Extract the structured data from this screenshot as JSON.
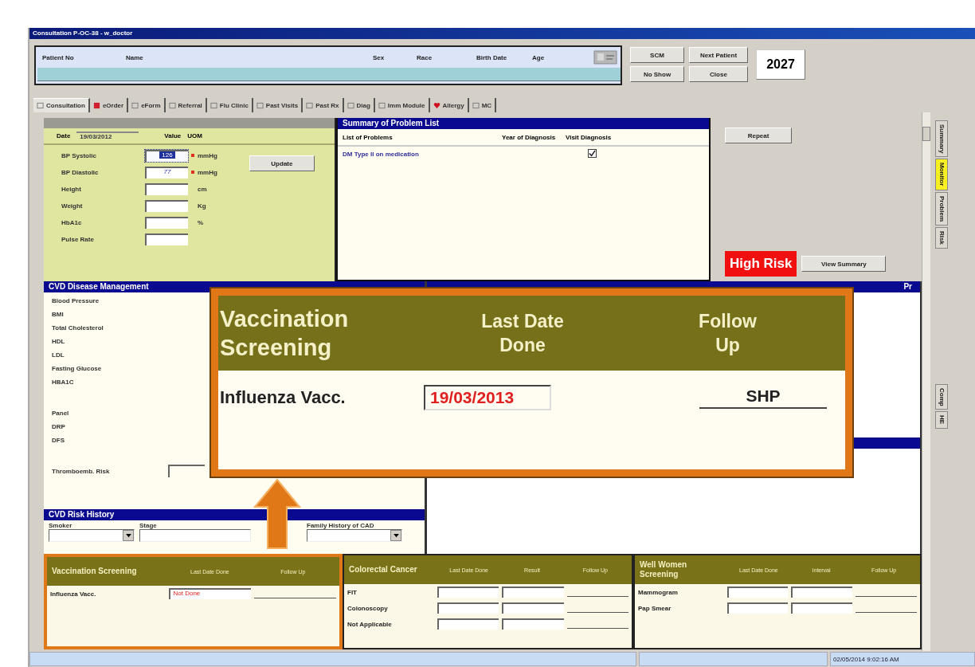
{
  "window": {
    "title": "Consultation P-OC-38 - w_doctor"
  },
  "patient": {
    "columns": [
      "Patient No",
      "Name",
      "Sex",
      "Race",
      "Birth Date",
      "Age"
    ]
  },
  "header_buttons": [
    "SCM",
    "Next Patient",
    "No Show",
    "Close"
  ],
  "queue_number": "2027",
  "tabs": [
    {
      "label": "Consultation",
      "kind": "box",
      "selected": true
    },
    {
      "label": "eOrder",
      "kind": "order",
      "selected": false
    },
    {
      "label": "eForm",
      "kind": "box",
      "selected": false
    },
    {
      "label": "Referral",
      "kind": "box",
      "selected": false
    },
    {
      "label": "Flu Clinic",
      "kind": "box",
      "selected": false
    },
    {
      "label": "Past Visits",
      "kind": "box",
      "selected": false
    },
    {
      "label": "Past Rx",
      "kind": "box",
      "selected": false
    },
    {
      "label": "Diag",
      "kind": "box",
      "selected": false
    },
    {
      "label": "Imm Module",
      "kind": "box",
      "selected": false
    },
    {
      "label": "Allergy",
      "kind": "heart",
      "selected": false
    },
    {
      "label": "MC",
      "kind": "box",
      "selected": false
    }
  ],
  "monitoring": {
    "date_label": "Date",
    "date": "19/03/2012",
    "value_label": "Value",
    "uom_label": "UOM",
    "button": "Update",
    "rows": [
      {
        "label": "BP Systolic",
        "value": "126",
        "selected": true,
        "required": true,
        "unit": "mmHg"
      },
      {
        "label": "BP Diastolic",
        "value": "77",
        "selected": false,
        "required": true,
        "unit": "mmHg"
      },
      {
        "label": "Height",
        "selected": false,
        "required": false,
        "unit": "cm"
      },
      {
        "label": "Weight",
        "selected": false,
        "required": false,
        "unit": "Kg"
      },
      {
        "label": "HbA1c",
        "selected": false,
        "required": false,
        "unit": "%"
      },
      {
        "label": "Pulse Rate",
        "selected": false,
        "required": false
      }
    ]
  },
  "problem_list": {
    "title": "Summary of Problem List",
    "columns": [
      "List of Problems",
      "Year of Diagnosis",
      "Visit Diagnosis"
    ],
    "rows": [
      {
        "problem": "DM Type II on medication",
        "visit_diagnosis": true
      }
    ]
  },
  "actions": {
    "repeat": "Repeat",
    "risk_badge": "High Risk",
    "view_summary": "View Summary"
  },
  "cvd": {
    "title": "CVD Disease Management",
    "items": [
      "Blood Pressure",
      "BMI",
      "Total Cholesterol",
      "HDL",
      "LDL",
      "Fasting Glucose",
      "HBA1C"
    ],
    "items_2": [
      "Panel",
      "DRP",
      "DFS"
    ],
    "thrombo_label": "Thromboemb. Risk"
  },
  "risk_history": {
    "title": "CVD Risk History",
    "fields": [
      {
        "label": "Smoker",
        "kind": "dropdown"
      },
      {
        "label": "Stage",
        "kind": "text"
      },
      {
        "label": "Family History of CAD",
        "kind": "dropdown"
      }
    ]
  },
  "right_panel": {
    "header_text": "Pr"
  },
  "screenings": [
    {
      "title": "Vaccination Screening",
      "highlighted": true,
      "columns": [
        "Last Date Done",
        "Follow Up"
      ],
      "rows": [
        {
          "name": "Influenza Vacc.",
          "last_date": "Not Done"
        }
      ]
    },
    {
      "title": "Colorectal Cancer",
      "highlighted": false,
      "columns": [
        "Last Date Done",
        "Result",
        "Follow Up"
      ],
      "rows": [
        {
          "name": "FIT"
        },
        {
          "name": "Colonoscopy"
        },
        {
          "name": "Not Applicable"
        }
      ]
    },
    {
      "title": "Well Women Screening",
      "highlighted": false,
      "columns": [
        "Last Date Done",
        "Interval",
        "Follow Up"
      ],
      "rows": [
        {
          "name": "Mammogram"
        },
        {
          "name": "Pap Smear"
        }
      ]
    }
  ],
  "callout": {
    "title": "Vaccination Screening",
    "columns": [
      "Last Date Done",
      "Follow Up"
    ],
    "row": {
      "name": "Influenza Vacc.",
      "last_date": "19/03/2013",
      "follow_up": "SHP"
    }
  },
  "side_tabs": [
    {
      "label": "Summary",
      "selected": false
    },
    {
      "label": "Monitor",
      "selected": true
    },
    {
      "label": "Problem",
      "selected": false
    },
    {
      "label": "Risk",
      "selected": false
    },
    {
      "label": "Comp",
      "selected": false
    },
    {
      "label": "HE",
      "selected": false
    }
  ],
  "status": {
    "timestamp": "02/05/2014 9:02:16 AM"
  }
}
